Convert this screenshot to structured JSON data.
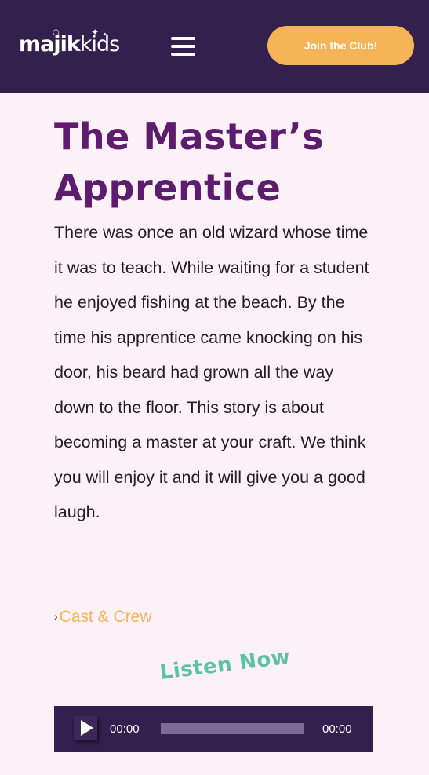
{
  "header": {
    "logo": {
      "primary": "majik",
      "secondary": "kids",
      "alt": "majikkids"
    },
    "menu_icon": "hamburger-menu-icon",
    "join_button_label": "Join the Club!"
  },
  "colors": {
    "header_bg": "#33204f",
    "page_bg": "#fdf1f8",
    "accent": "#f4b457",
    "title": "#5e1c6f",
    "listen_now": "#5cc3a1"
  },
  "main": {
    "title": "The Master’s Apprentice",
    "intro": "There was once an old wizard whose time it was to teach. While waiting for a student he enjoyed fishing at the beach. By the time his apprentice came knocking on his door, his beard had grown all the way down to the floor. This story is about becoming a master at your craft. We think you will enjoy it and it will give you a good laugh.",
    "cast_link": {
      "caret": "›",
      "label": "Cast & Crew"
    },
    "listen_heading": "Listen Now"
  },
  "audio_player": {
    "play_icon": "play-icon",
    "current_time": "00:00",
    "total_time": "00:00",
    "progress": 0
  }
}
